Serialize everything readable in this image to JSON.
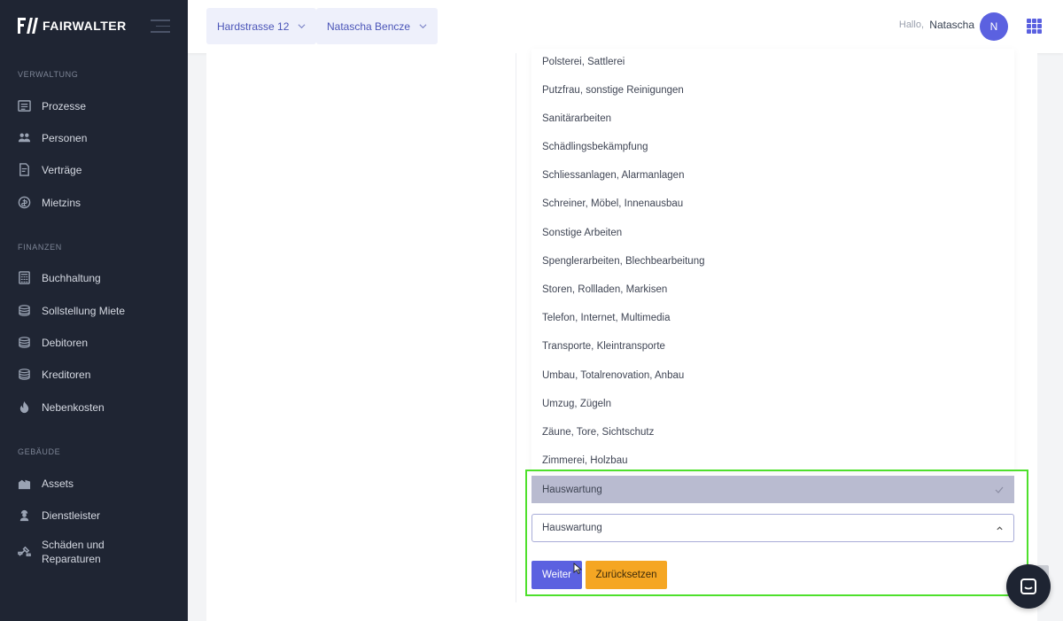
{
  "brand": {
    "name": "FAIRWALTER"
  },
  "sidebar": {
    "sections": [
      {
        "label": "VERWALTUNG",
        "items": [
          {
            "label": "Prozesse",
            "icon": "tasks-icon"
          },
          {
            "label": "Personen",
            "icon": "people-icon"
          },
          {
            "label": "Verträge",
            "icon": "contract-icon"
          },
          {
            "label": "Mietzins",
            "icon": "rent-icon"
          }
        ]
      },
      {
        "label": "FINANZEN",
        "items": [
          {
            "label": "Buchhaltung",
            "icon": "calculator-icon"
          },
          {
            "label": "Sollstellung Miete",
            "icon": "coins-icon"
          },
          {
            "label": "Debitoren",
            "icon": "coins-icon"
          },
          {
            "label": "Kreditoren",
            "icon": "coins-icon"
          },
          {
            "label": "Nebenkosten",
            "icon": "fire-icon"
          }
        ]
      },
      {
        "label": "GEBÄUDE",
        "items": [
          {
            "label": "Assets",
            "icon": "buildings-icon"
          },
          {
            "label": "Dienstleister",
            "icon": "worker-icon"
          },
          {
            "label": "Schäden und Reparaturen",
            "icon": "tools-icon"
          }
        ]
      }
    ]
  },
  "topbar": {
    "property_selector": "Hardstrasse 12",
    "person_selector": "Natascha Bencze",
    "greeting": "Hallo,",
    "user_name": "Natascha",
    "avatar_initial": "N"
  },
  "dropdown": {
    "options": [
      "Polsterei, Sattlerei",
      "Putzfrau, sonstige Reinigungen",
      "Sanitärarbeiten",
      "Schädlingsbekämpfung",
      "Schliessanlagen, Alarmanlagen",
      "Schreiner, Möbel, Innenausbau",
      "Sonstige Arbeiten",
      "Spenglerarbeiten, Blechbearbeitung",
      "Storen, Rollladen, Markisen",
      "Telefon, Internet, Multimedia",
      "Transporte, Kleintransporte",
      "Umbau, Totalrenovation, Anbau",
      "Umzug, Zügeln",
      "Zäune, Tore, Sichtschutz",
      "Zimmerei, Holzbau"
    ],
    "selected_option": "Hauswartung",
    "field_value": "Hauswartung"
  },
  "actions": {
    "next_label": "Weiter",
    "reset_label": "Zurücksetzen"
  },
  "colors": {
    "sidebar_bg": "#1f2533",
    "accent": "#5b61e0",
    "reset_button": "#f5a623",
    "highlight_frame": "#4ee02c",
    "selected_option_bg": "#b9bbd0"
  }
}
